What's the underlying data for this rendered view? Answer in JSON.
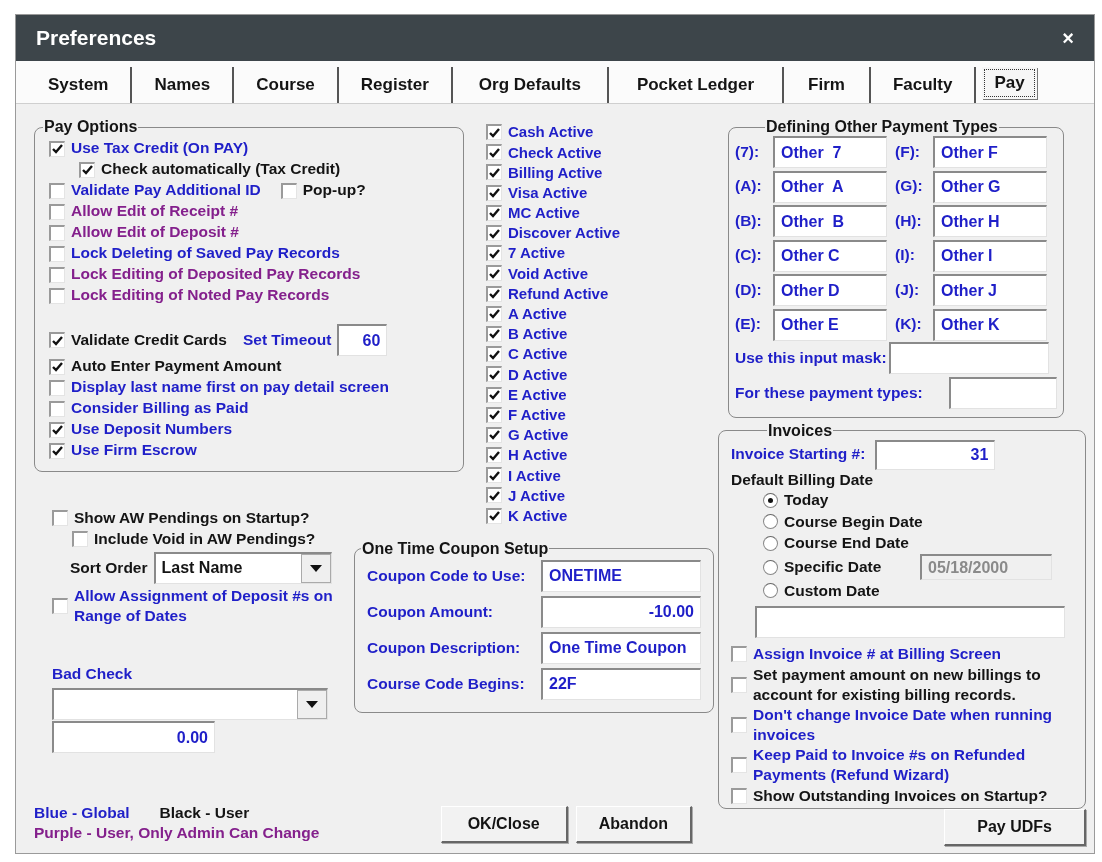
{
  "window": {
    "title": "Preferences",
    "close": "×"
  },
  "tabs": [
    {
      "label": "System",
      "selected": false
    },
    {
      "label": "Names",
      "selected": false
    },
    {
      "label": "Course",
      "selected": false
    },
    {
      "label": "Register",
      "selected": false
    },
    {
      "label": "Org Defaults",
      "selected": false
    },
    {
      "label": "Pocket Ledger",
      "selected": false
    },
    {
      "label": "Firm",
      "selected": false
    },
    {
      "label": "Faculty",
      "selected": false
    },
    {
      "label": "Pay",
      "selected": true
    }
  ],
  "pay_options": {
    "title": "Pay Options",
    "sections": [
      {
        "items": [
          {
            "label": "Use Tax Credit (On PAY)",
            "color": "#1f1fc8",
            "checked": true,
            "children": [
              {
                "label": "Check automatically (Tax Credit)",
                "color": "#141414",
                "checked": true
              }
            ]
          },
          {
            "label": "Validate Pay Additional ID",
            "color": "#1f1fc8",
            "checked": false,
            "extra": {
              "label": "Pop-up?",
              "color": "#141414",
              "checked": false
            }
          },
          {
            "label": "Allow Edit of Receipt #",
            "color": "#84208c",
            "checked": false
          },
          {
            "label": "Allow Edit of Deposit #",
            "color": "#84208c",
            "checked": false
          },
          {
            "label": "Lock Deleting of Saved Pay Records",
            "color": "#1f1fc8",
            "checked": false
          },
          {
            "label": "Lock Editing of Deposited Pay Records",
            "color": "#84208c",
            "checked": false
          },
          {
            "label": "Lock Editing of Noted Pay Records",
            "color": "#84208c",
            "checked": false
          }
        ]
      },
      {
        "items": [
          {
            "label": "Validate Credit Cards",
            "color": "#141414",
            "checked": true,
            "field": {
              "label": "Set Timeout",
              "value": "60"
            }
          },
          {
            "label": "Auto Enter Payment Amount",
            "color": "#141414",
            "checked": true
          },
          {
            "label": "Display last name first on pay detail screen",
            "color": "#1f1fc8",
            "checked": false
          },
          {
            "label": "Consider Billing as Paid",
            "color": "#1f1fc8",
            "checked": false
          },
          {
            "label": "Use Deposit Numbers",
            "color": "#1f1fc8",
            "checked": true
          },
          {
            "label": "Use Firm Escrow",
            "color": "#1f1fc8",
            "checked": true
          }
        ]
      }
    ]
  },
  "payment_types_active": [
    {
      "label": "Cash Active",
      "checked": true
    },
    {
      "label": "Check Active",
      "checked": true
    },
    {
      "label": "Billing Active",
      "checked": true
    },
    {
      "label": "Visa Active",
      "checked": true
    },
    {
      "label": "MC Active",
      "checked": true
    },
    {
      "label": "Discover Active",
      "checked": true
    },
    {
      "label": "7 Active",
      "checked": true
    },
    {
      "label": "Void Active",
      "checked": true
    },
    {
      "label": "Refund Active",
      "checked": true
    },
    {
      "label": "A Active",
      "checked": true
    },
    {
      "label": "B Active",
      "checked": true
    },
    {
      "label": "C Active",
      "checked": true
    },
    {
      "label": "D Active",
      "checked": true
    },
    {
      "label": "E Active",
      "checked": true
    },
    {
      "label": "F Active",
      "checked": true
    },
    {
      "label": "G Active",
      "checked": true
    },
    {
      "label": "H Active",
      "checked": true
    },
    {
      "label": "I Active",
      "checked": true
    },
    {
      "label": "J Active",
      "checked": true
    },
    {
      "label": "K Active",
      "checked": true
    }
  ],
  "aw_pendings": {
    "label": "Show AW Pendings on Startup?",
    "color": "#141414",
    "checked": false,
    "children": [
      {
        "label": "Include Void in AW Pendings?",
        "color": "#141414",
        "checked": false
      }
    ]
  },
  "sort_order": {
    "label": "Sort Order",
    "value": "Last Name"
  },
  "deposit_assignment": {
    "label": "Allow Assignment of Deposit #s on Range of Dates",
    "color": "#1f1fc8",
    "checked": false
  },
  "bad_check": {
    "label": "Bad Check",
    "amount": "0.00"
  },
  "coupon": {
    "title": "One Time Coupon Setup",
    "fields": [
      {
        "label": "Coupon Code to Use:",
        "value": "ONETIME",
        "right_aligned": false
      },
      {
        "label": "Coupon Amount:",
        "value": "-10.00",
        "right_aligned": true
      },
      {
        "label": "Coupon Description:",
        "value": "One Time Coupon",
        "right_aligned": false
      },
      {
        "label": "Course Code Begins:",
        "value": "22F",
        "right_aligned": false
      }
    ]
  },
  "legend": [
    {
      "label": "Blue - Global",
      "color": "#1f1fc8"
    },
    {
      "label": "Black - User",
      "color": "#141414"
    },
    {
      "label": "Purple - User, Only Admin Can Change",
      "color": "#84208c"
    }
  ],
  "buttons": [
    {
      "label": "OK/Close"
    },
    {
      "label": "Abandon"
    }
  ],
  "other_payment_types": {
    "title": "Defining Other Payment Types",
    "fields": [
      {
        "label": "(7):",
        "value": "Other  7"
      },
      {
        "label": "(F):",
        "value": "Other F"
      },
      {
        "label": "(A):",
        "value": "Other  A"
      },
      {
        "label": "(G):",
        "value": "Other G"
      },
      {
        "label": "(B):",
        "value": "Other  B"
      },
      {
        "label": "(H):",
        "value": "Other H"
      },
      {
        "label": "(C):",
        "value": "Other C"
      },
      {
        "label": "(I):",
        "value": "Other I"
      },
      {
        "label": "(D):",
        "value": "Other D"
      },
      {
        "label": "(J):",
        "value": "Other J"
      },
      {
        "label": "(E):",
        "value": "Other E"
      },
      {
        "label": "(K):",
        "value": "Other K"
      }
    ],
    "mask": {
      "label": "Use this input mask:"
    },
    "types": {
      "label": "For these payment types:"
    }
  },
  "invoices": {
    "title": "Invoices",
    "starting": {
      "label": "Invoice Starting #:",
      "value": "31"
    },
    "billing_date": {
      "label": "Default Billing Date",
      "options": [
        {
          "label": "Today",
          "selected": true
        },
        {
          "label": "Course Begin Date",
          "selected": false
        },
        {
          "label": "Course End Date",
          "selected": false
        },
        {
          "label": "Specific Date",
          "selected": false,
          "date": {
            "value": "05/18/2000",
            "disabled": true
          }
        },
        {
          "label": "Custom Date",
          "selected": false
        }
      ]
    },
    "options": [
      {
        "label": "Assign Invoice # at Billing Screen",
        "color": "#1f1fc8",
        "checked": false
      },
      {
        "label": "Set payment amount on new billings to account for existing billing records.",
        "color": "#141414",
        "checked": false
      },
      {
        "label": "Don't change Invoice Date when running invoices",
        "color": "#1f1fc8",
        "checked": false
      },
      {
        "label": "Keep Paid to Invoice #s on Refunded Payments (Refund Wizard)",
        "color": "#1f1fc8",
        "checked": false
      },
      {
        "label": "Show Outstanding Invoices on Startup?",
        "color": "#141414",
        "checked": false
      }
    ]
  },
  "udf_button": {
    "label": "Pay UDFs"
  }
}
